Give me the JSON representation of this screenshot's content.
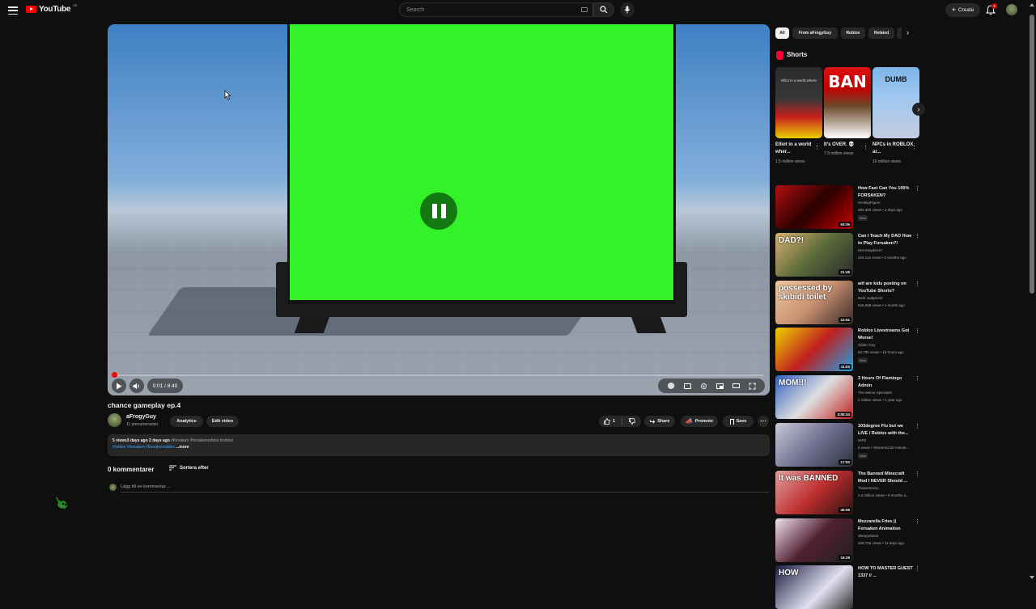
{
  "header": {
    "logo_text": "YouTube",
    "region": "SE",
    "search_placeholder": "Search",
    "create_label": "Create",
    "notification_count": "9"
  },
  "player": {
    "time": "0:01 / 8:40",
    "progress": 0.002,
    "state": "paused"
  },
  "video": {
    "title": "chance gameplay ep.4",
    "channel": "aFrogyGuy",
    "subscribers": "11 prenumeranter",
    "analytics_label": "Analytics",
    "edit_label": "Edit video",
    "likes": "1",
    "share_label": "Share",
    "promote_label": "Promote",
    "save_label": "Save"
  },
  "description": {
    "stats": "5 views3 days ago  2 days ago",
    "tags_line1": "#forsaken #forsakenroblox #roblox",
    "tags_line2": "#roblox #forsaken #forsakenroblox",
    "more": "...more"
  },
  "comments": {
    "count_label": "0 kommentarer",
    "sort_label": "Sortera efter",
    "add_placeholder": "Lägg till en kommentar ..."
  },
  "chips": [
    "All",
    "From aFrogyGuy",
    "Roblox",
    "Related"
  ],
  "shorts": {
    "title": "Shorts",
    "items": [
      {
        "title": "Elliot in a world wher...",
        "views": "1.5 million views",
        "thumb_text": "Elliot in a world where"
      },
      {
        "title": "It's OVER. 💀",
        "views": "7.9 million views",
        "thumb_text": "BAN"
      },
      {
        "title": "NPCs in ROBLOX ar...",
        "views": "16 million views",
        "thumb_text": "DUMB"
      }
    ]
  },
  "recommendations": [
    {
      "title": "How Fast Can You 100% FORSAKEN?",
      "channel": "SmilingFigure",
      "meta": "393,366 views • 3 days ago",
      "badge": "New",
      "duration": "53:35",
      "thumb_text": ""
    },
    {
      "title": "Can I Teach My DAD How to Play Forsaken?!",
      "channel": "HeroHayden47",
      "meta": "424,112 views • 2 months ago",
      "badge": "",
      "duration": "21:48",
      "thumb_text": "DAD?!"
    },
    {
      "title": "wtf are kids posting on YouTube Shorts?",
      "channel": "Dark Judgment",
      "meta": "626,699 views • 1 month ago",
      "badge": "",
      "duration": "12:51",
      "thumb_text": "possessed by skibidi toilet"
    },
    {
      "title": "Roblox Livestreams Got Worse!",
      "channel": "Glider Guy",
      "meta": "93,795 views • 18 hours ago",
      "badge": "New",
      "duration": "11:03",
      "thumb_text": ""
    },
    {
      "title": "3 Hours Of Flamingo Admin",
      "channel": "The Meme Specialist",
      "meta": "2 million views • 1 year ago",
      "badge": "",
      "duration": "3:00:34",
      "thumb_text": "MOM!!!"
    },
    {
      "title": "103degree Flu but we LIVE / Roblox with the...",
      "channel": "HIPE",
      "meta": "5 views • Streamed 50 minute...",
      "badge": "New",
      "duration": "17:53",
      "thumb_text": ""
    },
    {
      "title": "The Banned Minecraft Mod I NEVER Should ...",
      "channel": "TrainerDacio",
      "meta": "2.3 million views • 9 months a...",
      "badge": "",
      "duration": "35:06",
      "thumb_text": "It was BANNED"
    },
    {
      "title": "Mozzarella Fries || Forsaken Animation",
      "channel": "SleepyStars!",
      "meta": "468,756 views • 11 days ago",
      "badge": "",
      "duration": "16:28",
      "thumb_text": ""
    },
    {
      "title": "HOW TO MASTER GUEST 1337 // ...",
      "channel": "",
      "meta": "",
      "badge": "",
      "duration": "",
      "thumb_text": "HOW"
    }
  ]
}
